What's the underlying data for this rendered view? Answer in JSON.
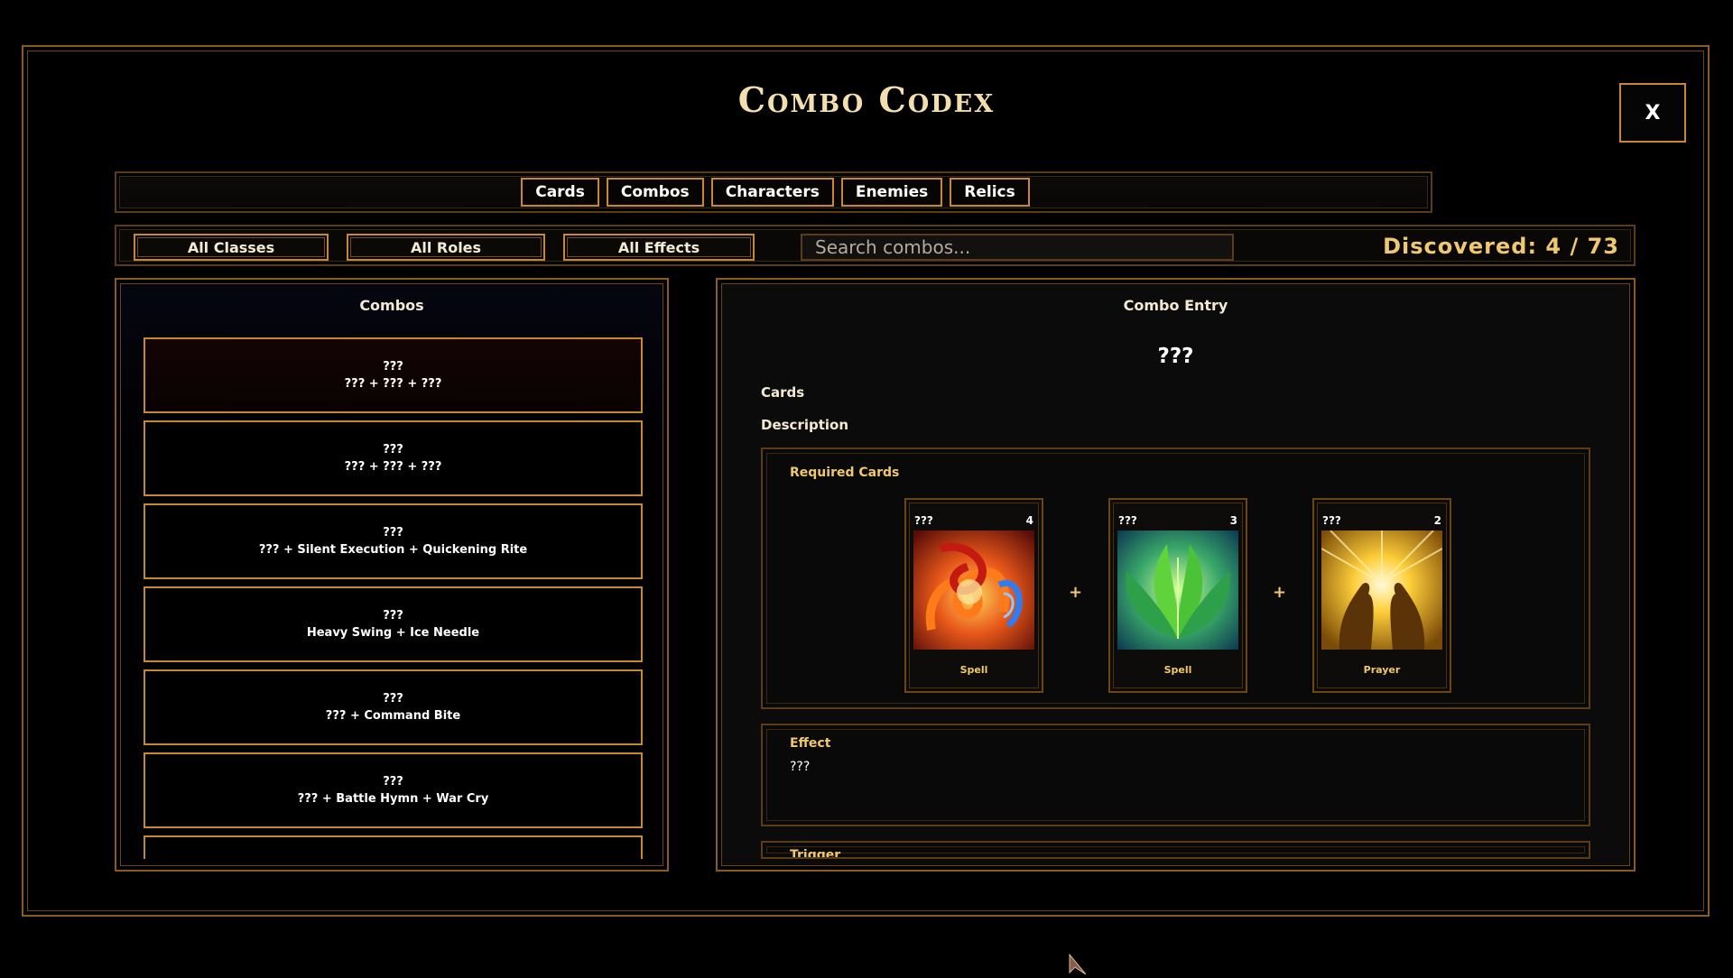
{
  "title": "Combo Codex",
  "close_label": "X",
  "tabs": [
    "Cards",
    "Combos",
    "Characters",
    "Enemies",
    "Relics"
  ],
  "filters": {
    "classes": "All Classes",
    "roles": "All Roles",
    "effects": "All Effects",
    "search_placeholder": "Search combos...",
    "discovered": "Discovered: 4 / 73"
  },
  "combos_panel": {
    "heading": "Combos",
    "items": [
      {
        "name": "???",
        "cards": "??? + ??? + ???"
      },
      {
        "name": "???",
        "cards": "??? + ??? + ???"
      },
      {
        "name": "???",
        "cards": "??? + Silent Execution + Quickening Rite"
      },
      {
        "name": "???",
        "cards": "Heavy Swing + Ice Needle"
      },
      {
        "name": "???",
        "cards": "??? + Command Bite"
      },
      {
        "name": "???",
        "cards": "??? + Battle Hymn + War Cry"
      }
    ]
  },
  "entry": {
    "heading": "Combo Entry",
    "name": "???",
    "cards_label": "Cards",
    "description_label": "Description",
    "required_title": "Required Cards",
    "required_cards": [
      {
        "name": "???",
        "cost": "4",
        "type": "Spell",
        "art": "fire-swirl"
      },
      {
        "name": "???",
        "cost": "3",
        "type": "Spell",
        "art": "green-leaves"
      },
      {
        "name": "???",
        "cost": "2",
        "type": "Prayer",
        "art": "golden-light-hands"
      }
    ],
    "plus": "+",
    "effect_title": "Effect",
    "effect_text": "???",
    "trigger_title": "Trigger"
  }
}
